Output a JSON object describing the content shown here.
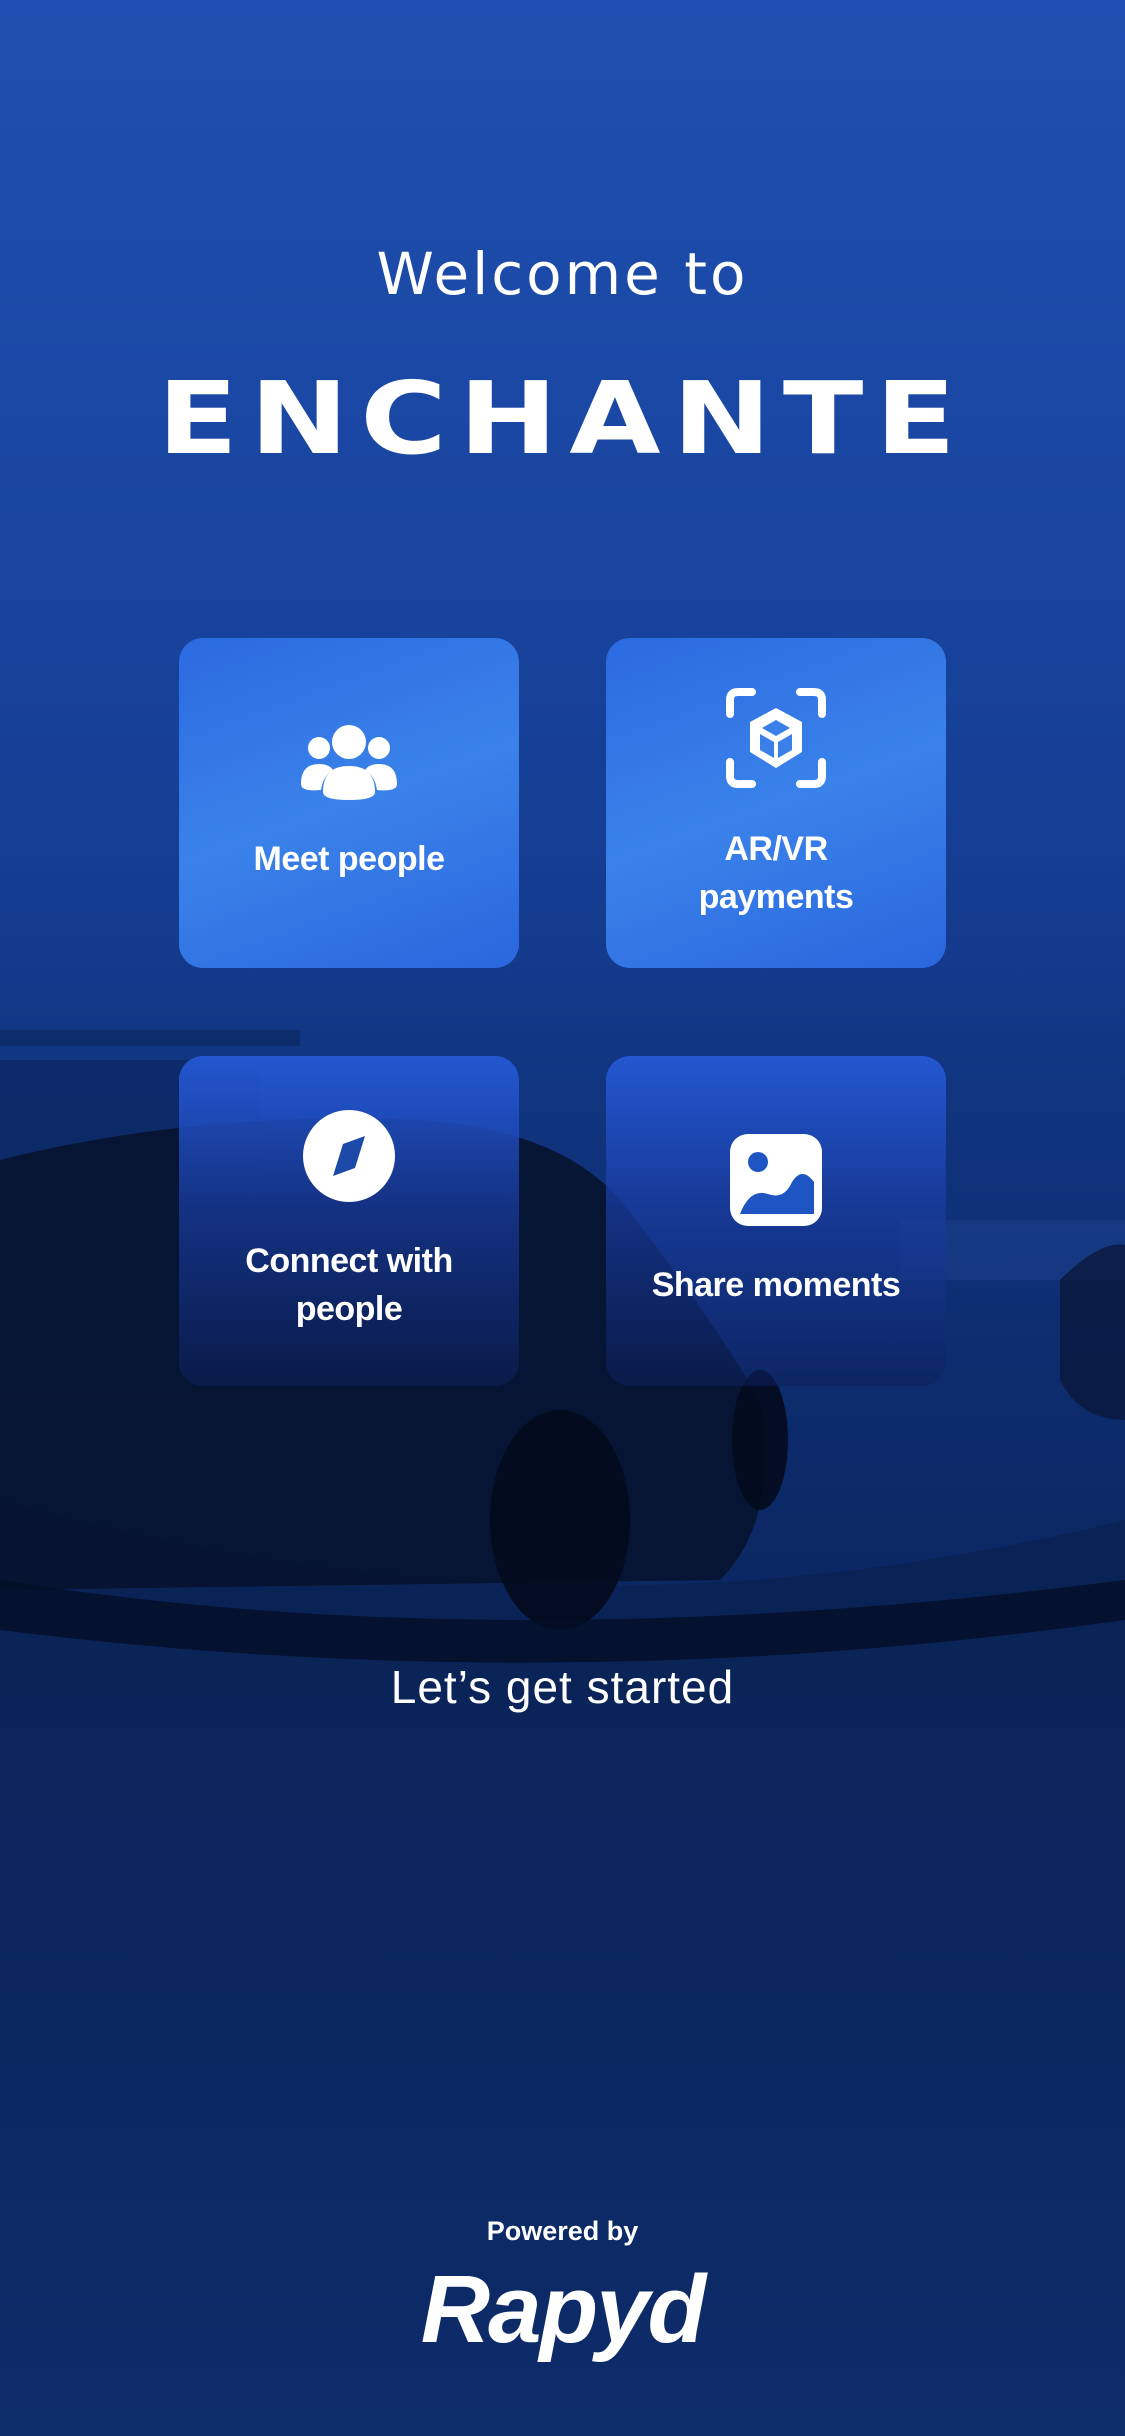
{
  "header": {
    "welcome": "Welcome to",
    "brand": "ENCHANTE"
  },
  "features": [
    {
      "label": "Meet people",
      "icon": "people-icon"
    },
    {
      "label": "AR/VR payments",
      "icon": "ar-cube-icon"
    },
    {
      "label": "Connect with people",
      "icon": "compass-icon"
    },
    {
      "label": "Share moments",
      "icon": "image-icon"
    }
  ],
  "cta": {
    "label": "Let’s get started"
  },
  "footer": {
    "powered_by": "Powered by",
    "partner": "Rapyd"
  },
  "colors": {
    "background": "#153e94",
    "tile": "#3478e6",
    "text": "#ffffff"
  }
}
